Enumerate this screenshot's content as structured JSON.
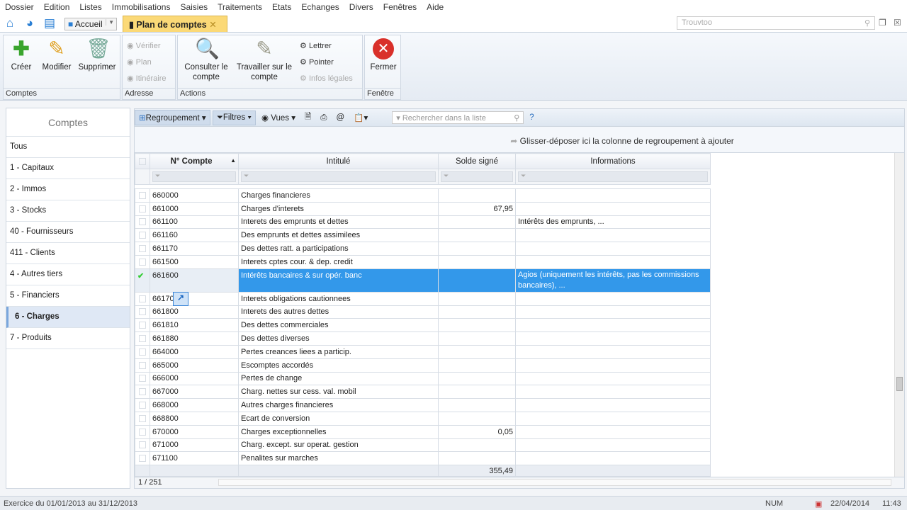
{
  "menu": [
    "Dossier",
    "Edition",
    "Listes",
    "Immobilisations",
    "Saisies",
    "Traitements",
    "Etats",
    "Echanges",
    "Divers",
    "Fenêtres",
    "Aide"
  ],
  "tabs": {
    "home": "Accueil",
    "active": "Plan de comptes"
  },
  "top_search": {
    "placeholder": "Trouvtoo"
  },
  "ribbon": {
    "comptes": {
      "label": "Comptes",
      "creer": "Créer",
      "modifier": "Modifier",
      "supprimer": "Supprimer"
    },
    "adresse": {
      "label": "Adresse",
      "verifier": "Vérifier",
      "plan": "Plan",
      "itineraire": "Itinéraire"
    },
    "actions": {
      "label": "Actions",
      "consulter": "Consulter le compte",
      "travailler": "Travailler sur le compte",
      "lettrer": "Lettrer",
      "pointer": "Pointer",
      "infos": "Infos légales"
    },
    "fenetre": {
      "label": "Fenêtre",
      "fermer": "Fermer"
    }
  },
  "left": {
    "title": "Comptes",
    "items": [
      "Tous",
      "1 - Capitaux",
      "2 - Immos",
      "3 - Stocks",
      "40 - Fournisseurs",
      "411 - Clients",
      "4 - Autres tiers",
      "5 - Financiers",
      "6 - Charges",
      "7 - Produits"
    ],
    "selected": 8
  },
  "grid": {
    "toolbar": {
      "regroupement": "Regroupement",
      "filtres": "Filtres",
      "vues": "Vues",
      "search_placeholder": "Rechercher dans la liste",
      "help": "?"
    },
    "drop_hint": "Glisser-déposer ici la colonne de regroupement à ajouter",
    "columns": [
      "N° Compte",
      "Intitulé",
      "Solde signé",
      "Informations"
    ],
    "rows": [
      [
        "660000",
        "Charges financieres",
        "",
        ""
      ],
      [
        "661000",
        "Charges d'interets",
        "67,95",
        ""
      ],
      [
        "661100",
        "Interets des emprunts et dettes",
        "",
        "Intérêts des emprunts, ..."
      ],
      [
        "661160",
        "Des emprunts et dettes assimilees",
        "",
        ""
      ],
      [
        "661170",
        "Des dettes ratt. a participations",
        "",
        ""
      ],
      [
        "661500",
        "Interets cptes cour. & dep. credit",
        "",
        ""
      ],
      [
        "661600",
        "Intérêts bancaires & sur opér. banc",
        "",
        "Agios (uniquement les intérêts, pas les commissions bancaires), ..."
      ],
      [
        "661700",
        "Interets obligations cautionnees",
        "",
        ""
      ],
      [
        "661800",
        "Interets des autres dettes",
        "",
        ""
      ],
      [
        "661810",
        "Des dettes commerciales",
        "",
        ""
      ],
      [
        "661880",
        "Des dettes diverses",
        "",
        ""
      ],
      [
        "664000",
        "Pertes creances liees a particip.",
        "",
        ""
      ],
      [
        "665000",
        "Escomptes accordés",
        "",
        ""
      ],
      [
        "666000",
        "Pertes de change",
        "",
        ""
      ],
      [
        "667000",
        "Charg. nettes sur cess. val. mobil",
        "",
        ""
      ],
      [
        "668000",
        "Autres charges financieres",
        "",
        ""
      ],
      [
        "668800",
        "Ecart de conversion",
        "",
        ""
      ],
      [
        "670000",
        "Charges exceptionnelles",
        "0,05",
        ""
      ],
      [
        "671000",
        "Charg. except. sur operat. gestion",
        "",
        ""
      ],
      [
        "671100",
        "Penalites sur marches",
        "",
        ""
      ]
    ],
    "selected_row": 6,
    "total": "355,49",
    "pager": "1 / 251"
  },
  "status": {
    "exercice": "Exercice du 01/01/2013 au 31/12/2013",
    "num": "NUM",
    "date": "22/04/2014",
    "time": "11:43"
  }
}
